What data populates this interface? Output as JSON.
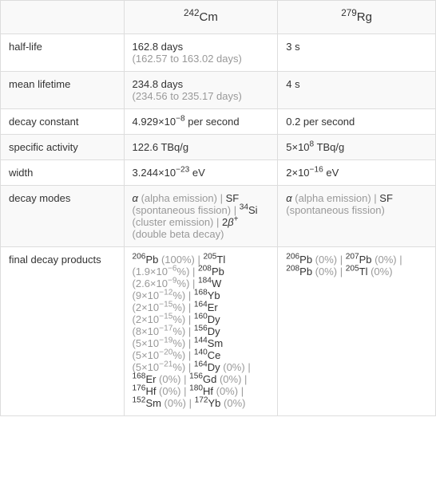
{
  "headers": {
    "col1": {
      "sup": "242",
      "el": "Cm"
    },
    "col2": {
      "sup": "279",
      "el": "Rg"
    }
  },
  "rows": {
    "half_life": {
      "label": "half-life",
      "c1_main": "162.8 days",
      "c1_gray": "(162.57 to 163.02 days)",
      "c2_main": "3 s"
    },
    "mean_lifetime": {
      "label": "mean lifetime",
      "c1_main": "234.8 days",
      "c1_gray": "(234.56 to 235.17 days)",
      "c2_main": "4 s"
    },
    "decay_constant": {
      "label": "decay constant",
      "c1_a": "4.929×10",
      "c1_exp": "−8",
      "c1_b": " per second",
      "c2_main": "0.2 per second"
    },
    "specific_activity": {
      "label": "specific activity",
      "c1_main": "122.6 TBq/g",
      "c2_a": "5×10",
      "c2_exp": "8",
      "c2_b": " TBq/g"
    },
    "width": {
      "label": "width",
      "c1_a": "3.244×10",
      "c1_exp": "−23",
      "c1_b": " eV",
      "c2_a": "2×10",
      "c2_exp": "−16",
      "c2_b": " eV"
    },
    "decay_modes": {
      "label": "decay modes",
      "c1_p1a": "α",
      "c1_p1b": " (alpha emission)",
      "sep1": " | ",
      "c1_p2a": "SF",
      "c1_p2b": " (spontaneous fission)",
      "sep2": " | ",
      "c1_p3s": "34",
      "c1_p3a": "Si",
      "c1_p3b": " (cluster emission)",
      "sep3": " | ",
      "c1_p4a": "2",
      "c1_p4b": "β",
      "c1_p4s": "+",
      "c1_p4c": " (double beta decay)",
      "c2_p1a": "α",
      "c2_p1b": " (alpha emission)",
      "c2_sep": " | ",
      "c2_p2a": "SF",
      "c2_p2b": " (spontaneous fission)"
    },
    "final_decay": {
      "label": "final decay products",
      "c1": {
        "i1_s": "206",
        "i1_n": "Pb",
        "i1_g": " (100%)",
        "sep": " | ",
        "i2_s": "205",
        "i2_n": "Tl",
        "i2_ga": " (1.9×10",
        "i2_ge": "−6",
        "i2_gb": "%)",
        "i3_s": "208",
        "i3_n": "Pb",
        "i3_ga": " (2.6×10",
        "i3_ge": "−9",
        "i3_gb": "%)",
        "i4_s": "184",
        "i4_n": "W",
        "i4_ga": " (9×10",
        "i4_ge": "−12",
        "i4_gb": "%)",
        "i5_s": "168",
        "i5_n": "Yb",
        "i5_ga": " (2×10",
        "i5_ge": "−15",
        "i5_gb": "%)",
        "i6_s": "164",
        "i6_n": "Er",
        "i6_ga": " (2×10",
        "i6_ge": "−15",
        "i6_gb": "%)",
        "i7_s": "160",
        "i7_n": "Dy",
        "i7_ga": " (8×10",
        "i7_ge": "−17",
        "i7_gb": "%)",
        "i8_s": "156",
        "i8_n": "Dy",
        "i8_ga": " (5×10",
        "i8_ge": "−19",
        "i8_gb": "%)",
        "i9_s": "144",
        "i9_n": "Sm",
        "i9_ga": " (5×10",
        "i9_ge": "−20",
        "i9_gb": "%)",
        "i10_s": "140",
        "i10_n": "Ce",
        "i10_ga": " (5×10",
        "i10_ge": "−21",
        "i10_gb": "%)",
        "i11_s": "164",
        "i11_n": "Dy",
        "i11_g": " (0%)",
        "i12_s": "168",
        "i12_n": "Er",
        "i12_g": " (0%)",
        "i13_s": "156",
        "i13_n": "Gd",
        "i13_g": " (0%)",
        "i14_s": "176",
        "i14_n": "Hf",
        "i14_g": " (0%)",
        "i15_s": "180",
        "i15_n": "Hf",
        "i15_g": " (0%)",
        "i16_s": "152",
        "i16_n": "Sm",
        "i16_g": " (0%)",
        "i17_s": "172",
        "i17_n": "Yb",
        "i17_g": " (0%)"
      },
      "c2": {
        "i1_s": "206",
        "i1_n": "Pb",
        "i1_g": " (0%)",
        "sep": " | ",
        "i2_s": "207",
        "i2_n": "Pb",
        "i2_g": " (0%)",
        "i3_s": "208",
        "i3_n": "Pb",
        "i3_g": " (0%)",
        "i4_s": "205",
        "i4_n": "Tl",
        "i4_g": " (0%)"
      }
    }
  }
}
